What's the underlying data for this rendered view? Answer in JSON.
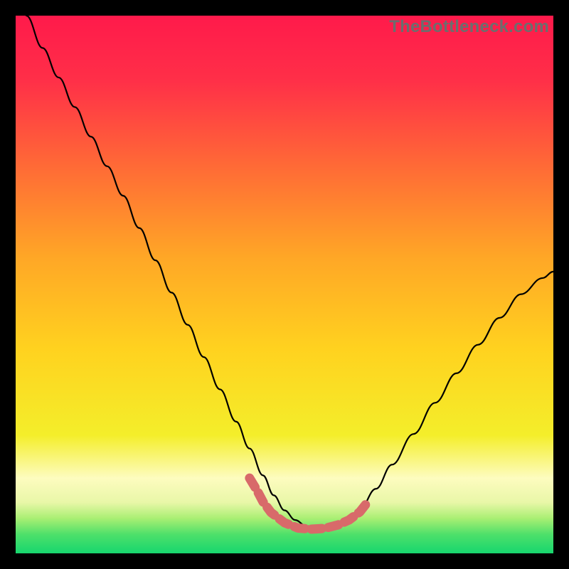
{
  "watermark": "TheBottleneck.com",
  "chart_data": {
    "type": "line",
    "title": "",
    "xlabel": "",
    "ylabel": "",
    "xlim": [
      0,
      100
    ],
    "ylim": [
      0,
      100
    ],
    "gradient_stops": [
      {
        "offset": 0.0,
        "color": "#ff1a4b"
      },
      {
        "offset": 0.12,
        "color": "#ff2f48"
      },
      {
        "offset": 0.28,
        "color": "#ff6a36"
      },
      {
        "offset": 0.45,
        "color": "#ffa726"
      },
      {
        "offset": 0.62,
        "color": "#ffd21f"
      },
      {
        "offset": 0.78,
        "color": "#f4ee2a"
      },
      {
        "offset": 0.86,
        "color": "#fdfcbf"
      },
      {
        "offset": 0.905,
        "color": "#e9f7a8"
      },
      {
        "offset": 0.935,
        "color": "#a9ef73"
      },
      {
        "offset": 0.965,
        "color": "#4de06a"
      },
      {
        "offset": 1.0,
        "color": "#17d66e"
      }
    ],
    "series": [
      {
        "name": "bottleneck-curve",
        "color": "#000000",
        "x": [
          2,
          5,
          8,
          11,
          14,
          17,
          20,
          23,
          26,
          29,
          32,
          35,
          38,
          41,
          43.5,
          46,
          48,
          50,
          52,
          54,
          56,
          58,
          60,
          62,
          64,
          67,
          70,
          74,
          78,
          82,
          86,
          90,
          94,
          98,
          100
        ],
        "y": [
          100,
          94,
          88.5,
          83,
          77.5,
          72,
          66.5,
          60.5,
          54.5,
          48.5,
          42.5,
          36.5,
          30.5,
          24.5,
          19.5,
          14.5,
          10.8,
          8.0,
          6.2,
          5.1,
          4.55,
          4.55,
          5.1,
          6.2,
          8.2,
          12.0,
          16.5,
          22.2,
          28.0,
          33.5,
          38.8,
          43.8,
          48.2,
          51.2,
          52.4
        ]
      }
    ],
    "marker_band": {
      "color": "#d86a6a",
      "x": [
        43.5,
        45,
        46,
        47.5,
        50,
        52.5,
        55,
        57.5,
        60,
        62,
        64,
        65.5
      ],
      "y": [
        14.0,
        11.5,
        9.6,
        7.6,
        5.7,
        4.7,
        4.5,
        4.65,
        5.3,
        6.2,
        7.7,
        9.6
      ]
    }
  }
}
